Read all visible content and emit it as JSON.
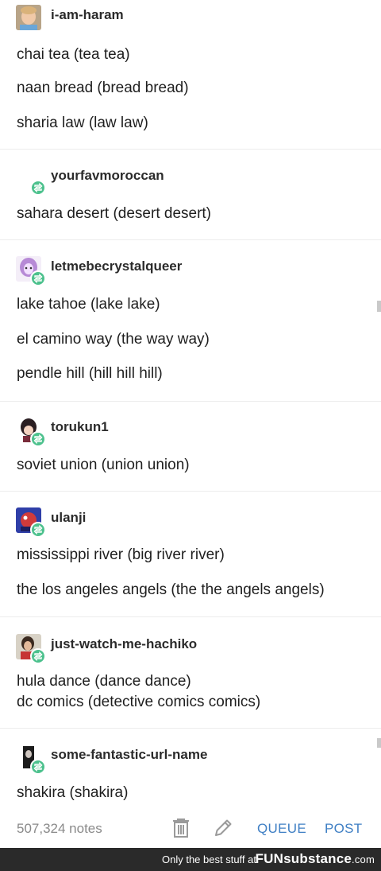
{
  "thread": [
    {
      "user": "i-am-haram",
      "avatar": "child-photo-avatar",
      "reblog": false,
      "lines": [
        "chai tea (tea tea)",
        "naan bread (bread bread)",
        "sharia law (law law)"
      ]
    },
    {
      "user": "yourfavmoroccan",
      "avatar": "none",
      "reblog": true,
      "lines": [
        "sahara desert (desert desert)"
      ]
    },
    {
      "user": "letmebecrystalqueer",
      "avatar": "purple-cartoon-avatar",
      "reblog": true,
      "lines": [
        "lake tahoe (lake lake)",
        "el camino way (the way way)",
        "pendle hill (hill hill hill)"
      ]
    },
    {
      "user": "torukun1",
      "avatar": "anime-character-avatar",
      "reblog": true,
      "lines": [
        "soviet union (union union)"
      ]
    },
    {
      "user": "ulanji",
      "avatar": "red-blue-cartoon-avatar",
      "reblog": true,
      "lines": [
        "mississippi river (big river river)",
        "the los angeles angels (the the angels angels)"
      ]
    },
    {
      "user": "just-watch-me-hachiko",
      "avatar": "person-photo-avatar",
      "reblog": true,
      "lines": [
        "hula dance (dance dance)",
        "dc comics (detective comics comics)"
      ]
    },
    {
      "user": "some-fantastic-url-name",
      "avatar": "dark-figure-avatar",
      "reblog": true,
      "lines": [
        "shakira (shakira)"
      ]
    }
  ],
  "footer": {
    "notes": "507,324 notes",
    "icons": [
      "trash-icon",
      "edit-pencil-icon"
    ],
    "queue_label": "QUEUE",
    "post_label": "POST",
    "accent": "#3f7fc4"
  },
  "brand": {
    "tagline": "Only the best stuff at",
    "logo_fun": "FUN",
    "logo_sub": "substance",
    "logo_dom": ".com"
  },
  "colors": {
    "reblog_badge": "#4cc18d",
    "brand_bar": "#2a2a2a"
  }
}
